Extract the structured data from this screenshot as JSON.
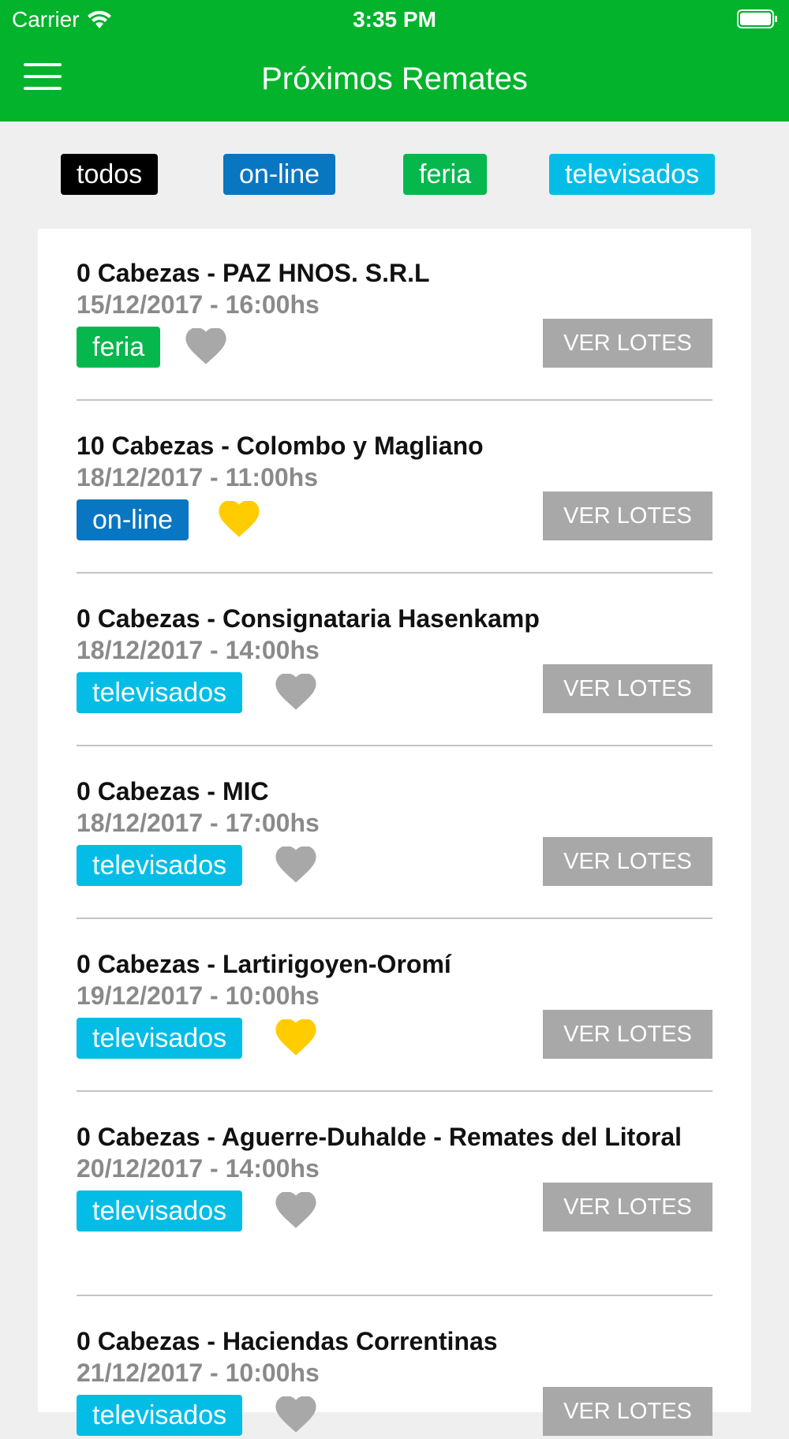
{
  "status_bar": {
    "carrier": "Carrier",
    "time": "3:35 PM"
  },
  "nav": {
    "title": "Próximos Remates"
  },
  "filters": [
    {
      "label": "todos",
      "color": "#000000"
    },
    {
      "label": "on-line",
      "color": "#0976c2"
    },
    {
      "label": "feria",
      "color": "#06b74e"
    },
    {
      "label": "televisados",
      "color": "#04bde6"
    }
  ],
  "colors": {
    "header": "#03b32b",
    "favorite": "#ffcc00",
    "not_favorite": "#a8a8a8",
    "button": "#a8a8a8"
  },
  "ver_lotes_label": "VER LOTES",
  "remates": [
    {
      "title": "0 Cabezas - PAZ HNOS. S.R.L",
      "date": "15/12/2017 - 16:00hs",
      "tag": "feria",
      "favorite": false
    },
    {
      "title": "10 Cabezas - Colombo y Magliano",
      "date": "18/12/2017 - 11:00hs",
      "tag": "on-line",
      "favorite": true
    },
    {
      "title": "0 Cabezas - Consignataria Hasenkamp",
      "date": "18/12/2017 - 14:00hs",
      "tag": "televisados",
      "favorite": false
    },
    {
      "title": "0 Cabezas - MIC",
      "date": "18/12/2017 - 17:00hs",
      "tag": "televisados",
      "favorite": false
    },
    {
      "title": "0 Cabezas - Lartirigoyen-Oromí",
      "date": "19/12/2017 - 10:00hs",
      "tag": "televisados",
      "favorite": true
    },
    {
      "title": "0 Cabezas - Aguerre-Duhalde - Remates del Litoral",
      "date": "20/12/2017 - 14:00hs",
      "tag": "televisados",
      "favorite": false
    },
    {
      "title": "0 Cabezas - Haciendas Correntinas",
      "date": "21/12/2017 - 10:00hs",
      "tag": "televisados",
      "favorite": false
    }
  ]
}
